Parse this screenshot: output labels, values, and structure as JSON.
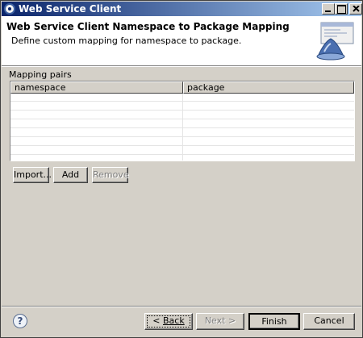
{
  "window": {
    "title": "Web Service Client"
  },
  "banner": {
    "title": "Web Service Client Namespace to Package Mapping",
    "description": "Define custom mapping for namespace to package."
  },
  "mapping": {
    "group_label": "Mapping pairs",
    "columns": [
      "namespace",
      "package"
    ],
    "rows": [
      [
        "",
        ""
      ],
      [
        "",
        ""
      ],
      [
        "",
        ""
      ],
      [
        "",
        ""
      ],
      [
        "",
        ""
      ],
      [
        "",
        ""
      ],
      [
        "",
        ""
      ],
      [
        "",
        ""
      ]
    ]
  },
  "actions": {
    "import_label": "Import...",
    "add_label": "Add",
    "remove_label": "Remove"
  },
  "footer": {
    "help_label": "?",
    "back_prefix": "< ",
    "back_label": "Back",
    "next_label": "Next >",
    "finish_label": "Finish",
    "cancel_label": "Cancel"
  },
  "icons": [
    "eclipse-app-icon",
    "minimize-icon",
    "maximize-icon",
    "close-icon",
    "wizard-banner-icon",
    "help-icon"
  ],
  "colors": {
    "titlebar_start": "#0a246a",
    "titlebar_end": "#a6caf0",
    "dialog_bg": "#d4d0c8",
    "banner_bg": "#ffffff"
  }
}
